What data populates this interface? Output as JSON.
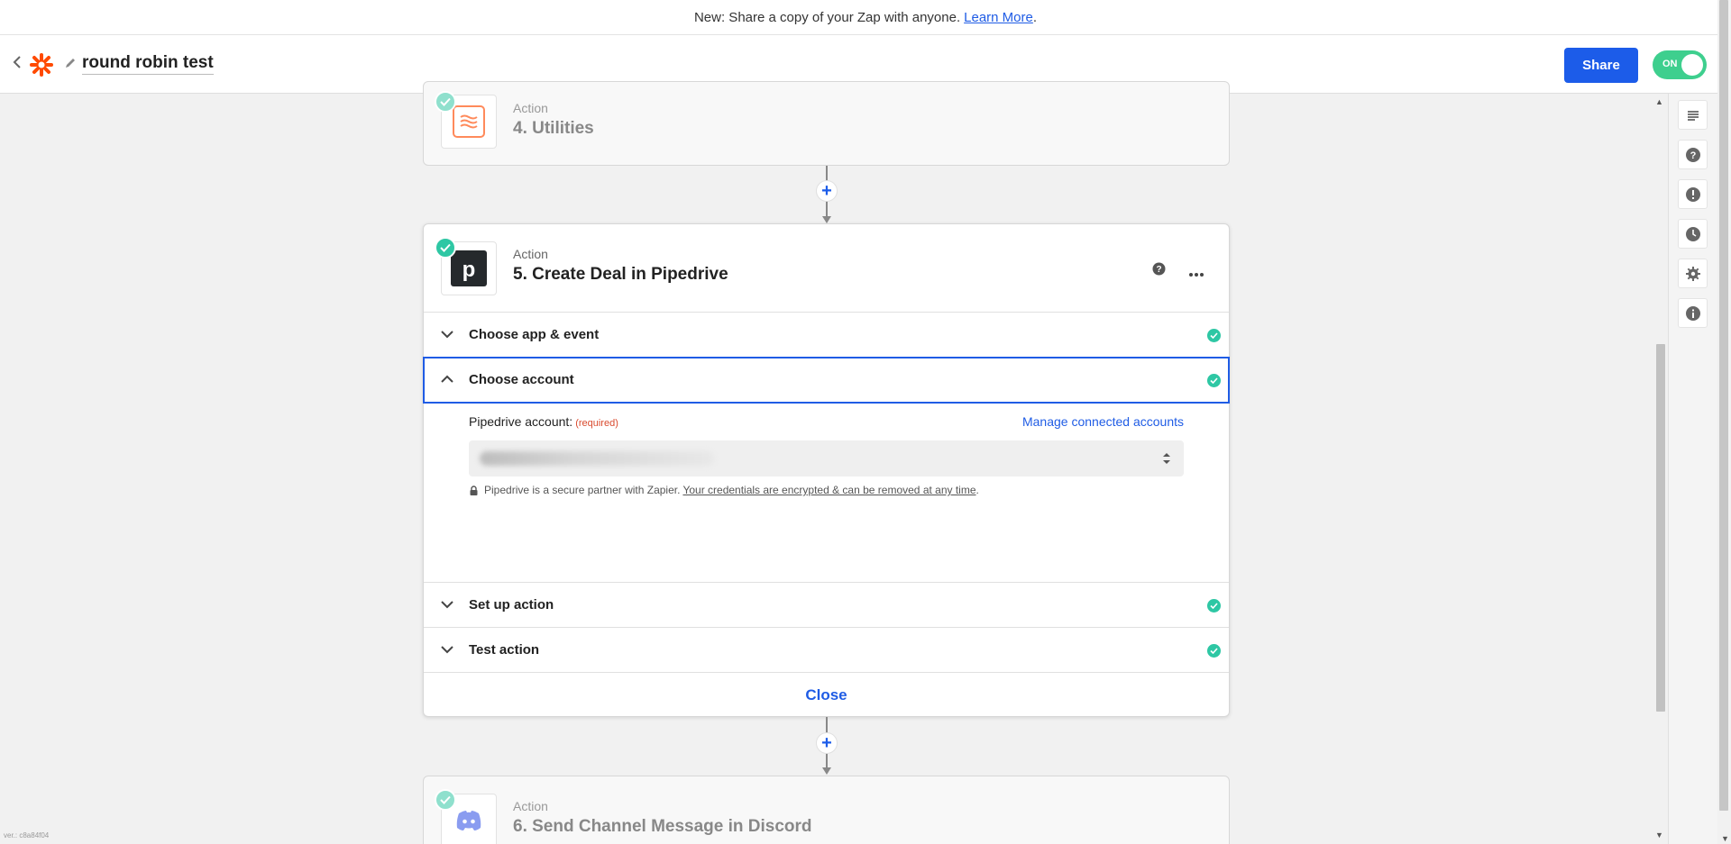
{
  "banner": {
    "text": "New: Share a copy of your Zap with anyone.",
    "link": "Learn More",
    "suffix": "."
  },
  "header": {
    "zap_title": "round robin test",
    "share_label": "Share",
    "toggle_label": "ON"
  },
  "steps": {
    "utilities": {
      "kicker": "Action",
      "title": "4. Utilities"
    },
    "pipedrive": {
      "kicker": "Action",
      "title": "5. Create Deal in Pipedrive",
      "sections": {
        "app_event": "Choose app & event",
        "account": "Choose account",
        "setup": "Set up action",
        "test": "Test action"
      },
      "account_field": {
        "label": "Pipedrive account:",
        "required": "(required)",
        "manage_link": "Manage connected accounts",
        "secure_text": "Pipedrive is a secure partner with Zapier.",
        "secure_link": "Your credentials are encrypted & can be removed at any time",
        "secure_suffix": "."
      },
      "close_label": "Close"
    },
    "discord": {
      "kicker": "Action",
      "title": "6. Send Channel Message in Discord"
    }
  },
  "sidebar": {
    "icons": [
      "list-icon",
      "help-icon",
      "alert-icon",
      "history-icon",
      "settings-icon",
      "info-icon"
    ]
  },
  "version": "ver.: c8a84f04",
  "colors": {
    "brand_blue": "#1c5ce9",
    "success_green": "#2ec7a4",
    "toggle_green": "#3ecf8e",
    "zapier_orange": "#ff4a00"
  }
}
